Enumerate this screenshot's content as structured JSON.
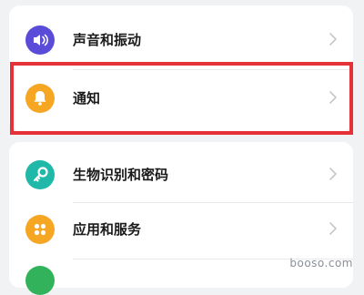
{
  "settings": {
    "items": [
      {
        "label": "声音和振动",
        "icon": "volume-icon",
        "color": "#5a4bd8"
      },
      {
        "label": "通知",
        "icon": "bell-icon",
        "color": "#f5a623"
      },
      {
        "label": "生物识别和密码",
        "icon": "key-icon",
        "color": "#1fb8a9"
      },
      {
        "label": "应用和服务",
        "icon": "apps-grid-icon",
        "color": "#f5a623"
      },
      {
        "label": "",
        "icon": "partial-icon",
        "color": "#32b35b"
      }
    ]
  },
  "highlight_color": "#e53238",
  "watermark": "booso.com"
}
